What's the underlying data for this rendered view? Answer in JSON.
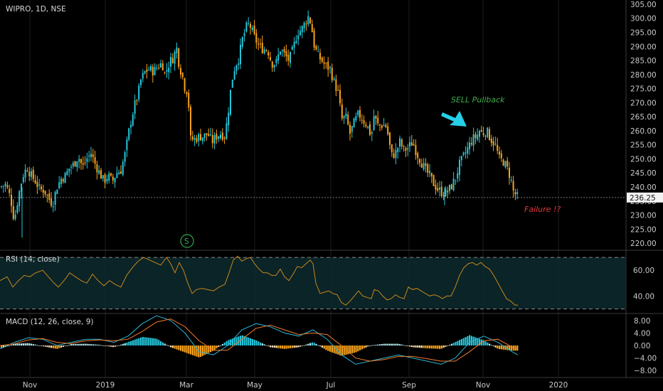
{
  "symbol_title": "WIPRO, 1D, NSE",
  "last_price": "236.25",
  "annotations": {
    "sell": "SELL Pullback",
    "failure": "Failure !?",
    "split_marker": "S"
  },
  "colors": {
    "up": "#26c6da",
    "down": "#f7a21b",
    "rsi_line": "#c8861c",
    "macd_line": "#29b6d6",
    "signal_line": "#f47b2a",
    "sell_text": "#3fae49",
    "failure_text": "#e0383e",
    "arrow": "#26d0e8"
  },
  "x_axis_labels": [
    "Nov",
    "2019",
    "Mar",
    "May",
    "Jul",
    "Sep",
    "Nov",
    "2020"
  ],
  "chart_data": [
    {
      "type": "candlestick",
      "title": "WIPRO, 1D, NSE",
      "y_ticks": [
        220,
        225,
        230,
        235,
        240,
        245,
        250,
        255,
        260,
        265,
        270,
        275,
        280,
        285,
        290,
        295,
        300,
        305
      ],
      "y_tick_labels": [
        "220.00",
        "225.00",
        "230.00",
        "235.00",
        "240.00",
        "245.00",
        "250.00",
        "255.00",
        "260.00",
        "265.00",
        "270.00",
        "275.00",
        "280.00",
        "285.00",
        "290.00",
        "295.00",
        "300.00",
        "305.00"
      ],
      "ylim": [
        217.5,
        306.5
      ],
      "close_path": [
        [
          0,
          240
        ],
        [
          8,
          241
        ],
        [
          15,
          236
        ],
        [
          20,
          228
        ],
        [
          26,
          237
        ],
        [
          32,
          244
        ],
        [
          38,
          247
        ],
        [
          44,
          244
        ],
        [
          50,
          242
        ],
        [
          56,
          239
        ],
        [
          62,
          239
        ],
        [
          68,
          236
        ],
        [
          74,
          234
        ],
        [
          80,
          240
        ],
        [
          86,
          243
        ],
        [
          92,
          244
        ],
        [
          98,
          247
        ],
        [
          104,
          248
        ],
        [
          110,
          251
        ],
        [
          116,
          247
        ],
        [
          122,
          250
        ],
        [
          128,
          252
        ],
        [
          134,
          248
        ],
        [
          140,
          245
        ],
        [
          146,
          242
        ],
        [
          152,
          244
        ],
        [
          158,
          242
        ],
        [
          164,
          245
        ],
        [
          170,
          246
        ],
        [
          176,
          252
        ],
        [
          182,
          261
        ],
        [
          188,
          268
        ],
        [
          194,
          273
        ],
        [
          198,
          278
        ],
        [
          204,
          281
        ],
        [
          210,
          282
        ],
        [
          216,
          281
        ],
        [
          222,
          283
        ],
        [
          228,
          284
        ],
        [
          232,
          280
        ],
        [
          236,
          283
        ],
        [
          240,
          285
        ],
        [
          244,
          286
        ],
        [
          248,
          290
        ],
        [
          252,
          283
        ],
        [
          256,
          280
        ],
        [
          260,
          275
        ],
        [
          264,
          274
        ],
        [
          268,
          257
        ],
        [
          274,
          257
        ],
        [
          280,
          258
        ],
        [
          286,
          258
        ],
        [
          292,
          259
        ],
        [
          298,
          256
        ],
        [
          304,
          258
        ],
        [
          310,
          259
        ],
        [
          316,
          258
        ],
        [
          320,
          265
        ],
        [
          324,
          274
        ],
        [
          328,
          281
        ],
        [
          332,
          284
        ],
        [
          336,
          286
        ],
        [
          340,
          292
        ],
        [
          344,
          295
        ],
        [
          348,
          298
        ],
        [
          352,
          297
        ],
        [
          358,
          293
        ],
        [
          364,
          290
        ],
        [
          370,
          289
        ],
        [
          376,
          289
        ],
        [
          382,
          284
        ],
        [
          388,
          284
        ],
        [
          394,
          289
        ],
        [
          400,
          287
        ],
        [
          406,
          285
        ],
        [
          412,
          289
        ],
        [
          418,
          295
        ],
        [
          424,
          296
        ],
        [
          430,
          299
        ],
        [
          434,
          301
        ],
        [
          438,
          297
        ],
        [
          441,
          291
        ],
        [
          446,
          287
        ],
        [
          452,
          285
        ],
        [
          458,
          283
        ],
        [
          464,
          282
        ],
        [
          470,
          277
        ],
        [
          476,
          273
        ],
        [
          480,
          264
        ],
        [
          486,
          265
        ],
        [
          492,
          259
        ],
        [
          498,
          263
        ],
        [
          504,
          266
        ],
        [
          510,
          264
        ],
        [
          516,
          262
        ],
        [
          522,
          258
        ],
        [
          526,
          266
        ],
        [
          530,
          262
        ],
        [
          536,
          262
        ],
        [
          542,
          262
        ],
        [
          546,
          258
        ],
        [
          550,
          251
        ],
        [
          556,
          252
        ],
        [
          562,
          256
        ],
        [
          568,
          253
        ],
        [
          574,
          254
        ],
        [
          580,
          256
        ],
        [
          586,
          252
        ],
        [
          592,
          249
        ],
        [
          598,
          246
        ],
        [
          604,
          244
        ],
        [
          610,
          241
        ],
        [
          616,
          239
        ],
        [
          622,
          238
        ],
        [
          628,
          238
        ],
        [
          634,
          240
        ],
        [
          640,
          243
        ],
        [
          646,
          248
        ],
        [
          652,
          251
        ],
        [
          658,
          254
        ],
        [
          664,
          257
        ],
        [
          670,
          258
        ],
        [
          674,
          260
        ],
        [
          678,
          259
        ],
        [
          684,
          260
        ],
        [
          690,
          257
        ],
        [
          696,
          255
        ],
        [
          702,
          250
        ],
        [
          708,
          249
        ],
        [
          714,
          246
        ],
        [
          718,
          243
        ],
        [
          722,
          238
        ],
        [
          726,
          237
        ],
        [
          728,
          236.25
        ]
      ],
      "last_close": 236.25,
      "horizontal_line": 236.25
    },
    {
      "type": "line",
      "title": "RSI (14, close)",
      "y_tick_labels": [
        "60.00",
        "40.00"
      ],
      "y_ticks": [
        60,
        40
      ],
      "ylim": [
        27,
        75
      ],
      "band": [
        30,
        70
      ],
      "path": [
        [
          0,
          52
        ],
        [
          10,
          55
        ],
        [
          18,
          47
        ],
        [
          26,
          52
        ],
        [
          34,
          56
        ],
        [
          42,
          55
        ],
        [
          50,
          58
        ],
        [
          60,
          60
        ],
        [
          68,
          55
        ],
        [
          76,
          50
        ],
        [
          82,
          47
        ],
        [
          90,
          52
        ],
        [
          98,
          58
        ],
        [
          106,
          55
        ],
        [
          114,
          52
        ],
        [
          122,
          50
        ],
        [
          130,
          57
        ],
        [
          138,
          52
        ],
        [
          146,
          48
        ],
        [
          154,
          52
        ],
        [
          162,
          49
        ],
        [
          170,
          47
        ],
        [
          178,
          56
        ],
        [
          186,
          62
        ],
        [
          194,
          67
        ],
        [
          202,
          70
        ],
        [
          210,
          68
        ],
        [
          218,
          66
        ],
        [
          226,
          64
        ],
        [
          234,
          70
        ],
        [
          240,
          65
        ],
        [
          246,
          58
        ],
        [
          252,
          66
        ],
        [
          258,
          60
        ],
        [
          264,
          50
        ],
        [
          270,
          42
        ],
        [
          276,
          45
        ],
        [
          284,
          46
        ],
        [
          292,
          45
        ],
        [
          300,
          44
        ],
        [
          308,
          47
        ],
        [
          316,
          49
        ],
        [
          322,
          58
        ],
        [
          328,
          68
        ],
        [
          334,
          71
        ],
        [
          340,
          67
        ],
        [
          346,
          69
        ],
        [
          352,
          70
        ],
        [
          358,
          65
        ],
        [
          364,
          61
        ],
        [
          370,
          58
        ],
        [
          376,
          58
        ],
        [
          382,
          56
        ],
        [
          388,
          56
        ],
        [
          394,
          61
        ],
        [
          400,
          55
        ],
        [
          406,
          52
        ],
        [
          412,
          57
        ],
        [
          418,
          63
        ],
        [
          424,
          62
        ],
        [
          430,
          65
        ],
        [
          436,
          68
        ],
        [
          440,
          65
        ],
        [
          444,
          50
        ],
        [
          450,
          42
        ],
        [
          456,
          43
        ],
        [
          462,
          44
        ],
        [
          468,
          42
        ],
        [
          474,
          41
        ],
        [
          480,
          35
        ],
        [
          486,
          33
        ],
        [
          492,
          36
        ],
        [
          498,
          40
        ],
        [
          504,
          44
        ],
        [
          510,
          40
        ],
        [
          516,
          39
        ],
        [
          522,
          38
        ],
        [
          526,
          45
        ],
        [
          532,
          44
        ],
        [
          538,
          40
        ],
        [
          544,
          37
        ],
        [
          550,
          38
        ],
        [
          556,
          41
        ],
        [
          562,
          39
        ],
        [
          568,
          38
        ],
        [
          574,
          47
        ],
        [
          580,
          45
        ],
        [
          586,
          46
        ],
        [
          592,
          44
        ],
        [
          598,
          42
        ],
        [
          604,
          40
        ],
        [
          610,
          41
        ],
        [
          616,
          40
        ],
        [
          622,
          38
        ],
        [
          628,
          40
        ],
        [
          634,
          40
        ],
        [
          640,
          47
        ],
        [
          646,
          56
        ],
        [
          652,
          62
        ],
        [
          658,
          65
        ],
        [
          664,
          66
        ],
        [
          670,
          64
        ],
        [
          676,
          66
        ],
        [
          682,
          63
        ],
        [
          688,
          61
        ],
        [
          694,
          56
        ],
        [
          700,
          50
        ],
        [
          706,
          44
        ],
        [
          712,
          38
        ],
        [
          718,
          36
        ],
        [
          724,
          33
        ],
        [
          728,
          33
        ]
      ]
    },
    {
      "type": "macd",
      "title": "MACD (12, 26, close, 9)",
      "y_tick_labels": [
        "8.00",
        "4.00",
        "0.00",
        "−4.00",
        "−8.00"
      ],
      "y_ticks": [
        8,
        4,
        0,
        -4,
        -8
      ],
      "ylim": [
        -10,
        10
      ],
      "macd": [
        [
          0,
          -1
        ],
        [
          20,
          1
        ],
        [
          40,
          2.5
        ],
        [
          60,
          2
        ],
        [
          80,
          0
        ],
        [
          100,
          1
        ],
        [
          120,
          2
        ],
        [
          140,
          2
        ],
        [
          160,
          1
        ],
        [
          180,
          3
        ],
        [
          200,
          7
        ],
        [
          220,
          9.5
        ],
        [
          240,
          8
        ],
        [
          260,
          4
        ],
        [
          280,
          -2
        ],
        [
          300,
          -3
        ],
        [
          320,
          0
        ],
        [
          340,
          5
        ],
        [
          360,
          7
        ],
        [
          380,
          6
        ],
        [
          400,
          4
        ],
        [
          420,
          3
        ],
        [
          440,
          5
        ],
        [
          460,
          2
        ],
        [
          480,
          -3
        ],
        [
          500,
          -6
        ],
        [
          520,
          -5
        ],
        [
          540,
          -4
        ],
        [
          560,
          -3
        ],
        [
          580,
          -4
        ],
        [
          600,
          -5
        ],
        [
          620,
          -6
        ],
        [
          640,
          -4
        ],
        [
          660,
          1
        ],
        [
          680,
          3
        ],
        [
          700,
          1
        ],
        [
          720,
          -2
        ],
        [
          728,
          -3
        ]
      ],
      "signal": [
        [
          0,
          0
        ],
        [
          20,
          0.5
        ],
        [
          40,
          1.8
        ],
        [
          60,
          2.2
        ],
        [
          80,
          1
        ],
        [
          100,
          0.6
        ],
        [
          120,
          1.5
        ],
        [
          140,
          1.8
        ],
        [
          160,
          1.5
        ],
        [
          180,
          2
        ],
        [
          200,
          4.5
        ],
        [
          220,
          7.5
        ],
        [
          240,
          8.5
        ],
        [
          260,
          6
        ],
        [
          280,
          1.5
        ],
        [
          300,
          -1.5
        ],
        [
          320,
          -1.5
        ],
        [
          340,
          2
        ],
        [
          360,
          5.5
        ],
        [
          380,
          6.5
        ],
        [
          400,
          5
        ],
        [
          420,
          3.5
        ],
        [
          440,
          4
        ],
        [
          460,
          3.5
        ],
        [
          480,
          0
        ],
        [
          500,
          -4
        ],
        [
          520,
          -5
        ],
        [
          540,
          -4.5
        ],
        [
          560,
          -3.5
        ],
        [
          580,
          -3.5
        ],
        [
          600,
          -4.2
        ],
        [
          620,
          -5
        ],
        [
          640,
          -5
        ],
        [
          660,
          -2
        ],
        [
          680,
          1.5
        ],
        [
          700,
          2
        ],
        [
          720,
          -0.5
        ],
        [
          728,
          -1.5
        ]
      ]
    }
  ]
}
